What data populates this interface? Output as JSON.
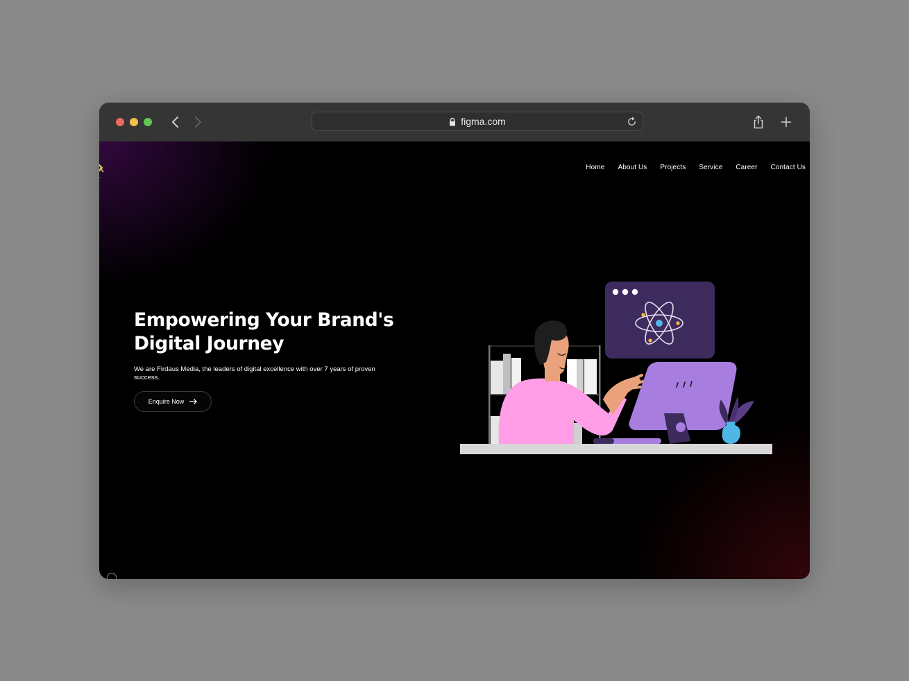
{
  "browser": {
    "url": "figma.com",
    "colors": {
      "close": "#ed6a5e",
      "minimize": "#f4bf4f",
      "zoom": "#61c554",
      "toolbar": "#353535"
    }
  },
  "nav": {
    "items": [
      "Home",
      "About Us",
      "Projects",
      "Service",
      "Career",
      "Contact Us"
    ]
  },
  "hero": {
    "title_line1": "Empowering Your Brand's",
    "title_line2": "Digital Journey",
    "subtitle": "We are Firdaus Media, the leaders of digital excellence with over 7 years of proven success.",
    "cta_label": "Enquire Now",
    "cta_icon": "arrow-right-icon"
  },
  "illustration": {
    "subject": "person-at-computer",
    "colors": {
      "window": "#3e2b5e",
      "atom": "#e6dff2",
      "atom_core": "#4fb6e6",
      "shirt": "#ff9ee6",
      "skin": "#e9a27c",
      "hair": "#1e1e1e",
      "monitor": "#a77ee0",
      "vase": "#4fb6e6",
      "desk": "#d8d8d8"
    }
  }
}
